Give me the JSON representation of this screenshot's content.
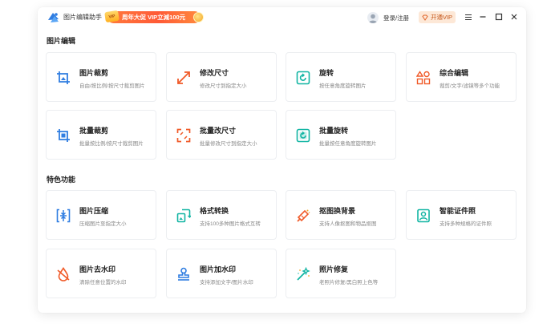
{
  "app": {
    "name": "图片编辑助手"
  },
  "promo": {
    "badge": "VIP",
    "text": "周年大促 VIP立減100元"
  },
  "header": {
    "login": "登录/注册",
    "vip_button": "开通VIP"
  },
  "sections": [
    {
      "title": "图片编辑"
    },
    {
      "title": "特色功能"
    }
  ],
  "cards": {
    "crop": {
      "title": "图片裁剪",
      "desc": "自由/按比例/按尺寸裁剪图片"
    },
    "resize": {
      "title": "修改尺寸",
      "desc": "修改尺寸到指定大小"
    },
    "rotate": {
      "title": "旋转",
      "desc": "按任意角度旋转图片"
    },
    "edit": {
      "title": "综合编辑",
      "desc": "裁剪/文字/滤镜等多个功能"
    },
    "batch_crop": {
      "title": "批量裁剪",
      "desc": "批量按比例/按尺寸裁剪图片"
    },
    "batch_resize": {
      "title": "批量改尺寸",
      "desc": "批量修改尺寸到指定大小"
    },
    "batch_rotate": {
      "title": "批量旋转",
      "desc": "批量按任意角度旋转图片"
    },
    "compress": {
      "title": "图片压缩",
      "desc": "压缩图片至指定大小"
    },
    "convert": {
      "title": "格式转换",
      "desc": "支持100多种图片格式互转"
    },
    "cutout": {
      "title": "抠图换背景",
      "desc": "支持人像抠图和物品抠图"
    },
    "id_photo": {
      "title": "智能证件照",
      "desc": "支持多种规格的证件照"
    },
    "remove_wm": {
      "title": "图片去水印",
      "desc": "清除任意位置的水印"
    },
    "add_wm": {
      "title": "图片加水印",
      "desc": "支持添加文字/图片水印"
    },
    "restore": {
      "title": "照片修复",
      "desc": "老照片修复/黑白照上色等"
    }
  },
  "colors": {
    "accent": "#2f7de1",
    "orange": "#f05a28",
    "teal": "#12b5a3",
    "vip": "#c5561a"
  }
}
